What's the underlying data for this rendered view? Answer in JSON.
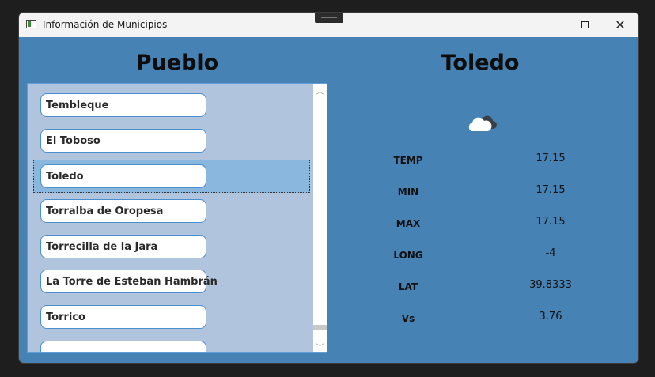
{
  "window": {
    "title": "Información de Municipios"
  },
  "controls": {
    "minimize": "minimize",
    "maximize": "maximize",
    "close": "close"
  },
  "left": {
    "heading": "Pueblo",
    "items": [
      {
        "label": "Tembleque"
      },
      {
        "label": "El Toboso"
      },
      {
        "label": "Toledo",
        "selected": true
      },
      {
        "label": "Torralba de Oropesa"
      },
      {
        "label": "Torrecilla de la Jara"
      },
      {
        "label": "La Torre de Esteban Hambrán"
      },
      {
        "label": "Torrico"
      },
      {
        "label": ""
      }
    ]
  },
  "right": {
    "heading": "Toledo",
    "weather_icon": "cloud-icon",
    "stats": [
      {
        "label": "TEMP",
        "value": "17.15"
      },
      {
        "label": "MIN",
        "value": "17.15"
      },
      {
        "label": "MAX",
        "value": "17.15"
      },
      {
        "label": "LONG",
        "value": "-4"
      },
      {
        "label": "LAT",
        "value": "39.8333"
      },
      {
        "label": "Vs",
        "value": "3.76"
      }
    ]
  },
  "colors": {
    "window_bg": "#4682b4",
    "list_bg": "#b0c4de",
    "selection": "#8ab7dd",
    "item_border": "#4a8fd0"
  }
}
